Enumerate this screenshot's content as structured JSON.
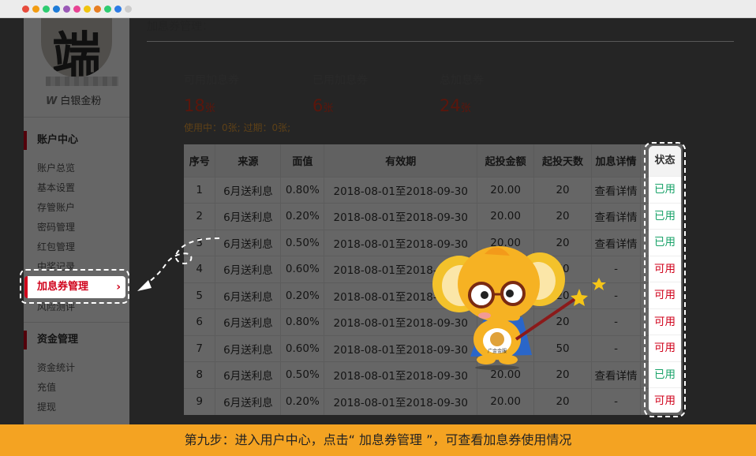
{
  "browser": {
    "dot_colors": [
      "#e74c3c",
      "#f39c12",
      "#2ecc71",
      "#1e7bd8",
      "#9b59b6",
      "#e84393",
      "#f1c40f",
      "#e67e22",
      "#2ecc71",
      "#2c7be5",
      "#cccccc"
    ]
  },
  "sidebar": {
    "avatar_text": "端午",
    "level": "白银金粉",
    "account_center": "账户中心",
    "account_items": [
      "账户总览",
      "基本设置",
      "存管账户",
      "密码管理",
      "红包管理",
      "中奖记录"
    ],
    "active_item": "加息券管理",
    "risk_item": "风险测评",
    "funds_section": "资金管理",
    "funds_items": [
      "资金统计",
      "充值",
      "提现"
    ]
  },
  "main": {
    "title": "加息券管理：",
    "summary": [
      {
        "label": "可用加息券",
        "value": "18",
        "unit": "张"
      },
      {
        "label": "已用加息券",
        "value": "6",
        "unit": "张"
      },
      {
        "label": "总加息券",
        "value": "24",
        "unit": "张"
      }
    ],
    "usage_note": "使用中：0张; 过期：0张;",
    "table": {
      "headers": [
        "序号",
        "来源",
        "面值",
        "有效期",
        "起投金额",
        "起投天数",
        "加息详情",
        "状态"
      ],
      "rows": [
        [
          "1",
          "6月送利息",
          "0.80%",
          "2018-08-01至2018-09-30",
          "20.00",
          "20",
          "查看详情",
          "已用"
        ],
        [
          "2",
          "6月送利息",
          "0.20%",
          "2018-08-01至2018-09-30",
          "20.00",
          "20",
          "查看详情",
          "已用"
        ],
        [
          "3",
          "6月送利息",
          "0.50%",
          "2018-08-01至2018-09-30",
          "20.00",
          "20",
          "查看详情",
          "已用"
        ],
        [
          "4",
          "6月送利息",
          "0.60%",
          "2018-08-01至2018-09-30",
          "20.00",
          "50",
          "-",
          "可用"
        ],
        [
          "5",
          "6月送利息",
          "0.20%",
          "2018-08-01至2018-09-30",
          "20.00",
          "20",
          "-",
          "可用"
        ],
        [
          "6",
          "6月送利息",
          "0.80%",
          "2018-08-01至2018-09-30",
          "20.00",
          "20",
          "-",
          "可用"
        ],
        [
          "7",
          "6月送利息",
          "0.60%",
          "2018-08-01至2018-09-30",
          "20.00",
          "50",
          "-",
          "可用"
        ],
        [
          "8",
          "6月送利息",
          "0.50%",
          "2018-08-01至2018-09-30",
          "20.00",
          "20",
          "查看详情",
          "已用"
        ],
        [
          "9",
          "6月送利息",
          "0.20%",
          "2018-08-01至2018-09-30",
          "20.00",
          "20",
          "-",
          "可用"
        ]
      ]
    }
  },
  "colors": {
    "used": "#1aa36a",
    "available": "#d0021b",
    "accent": "#d0021b"
  },
  "mascot": {
    "badge_text": "广金金服"
  },
  "footer": {
    "instruction": "第九步：进入用户中心，点击“ 加息券管理 ”，可查看加息券使用情况"
  }
}
